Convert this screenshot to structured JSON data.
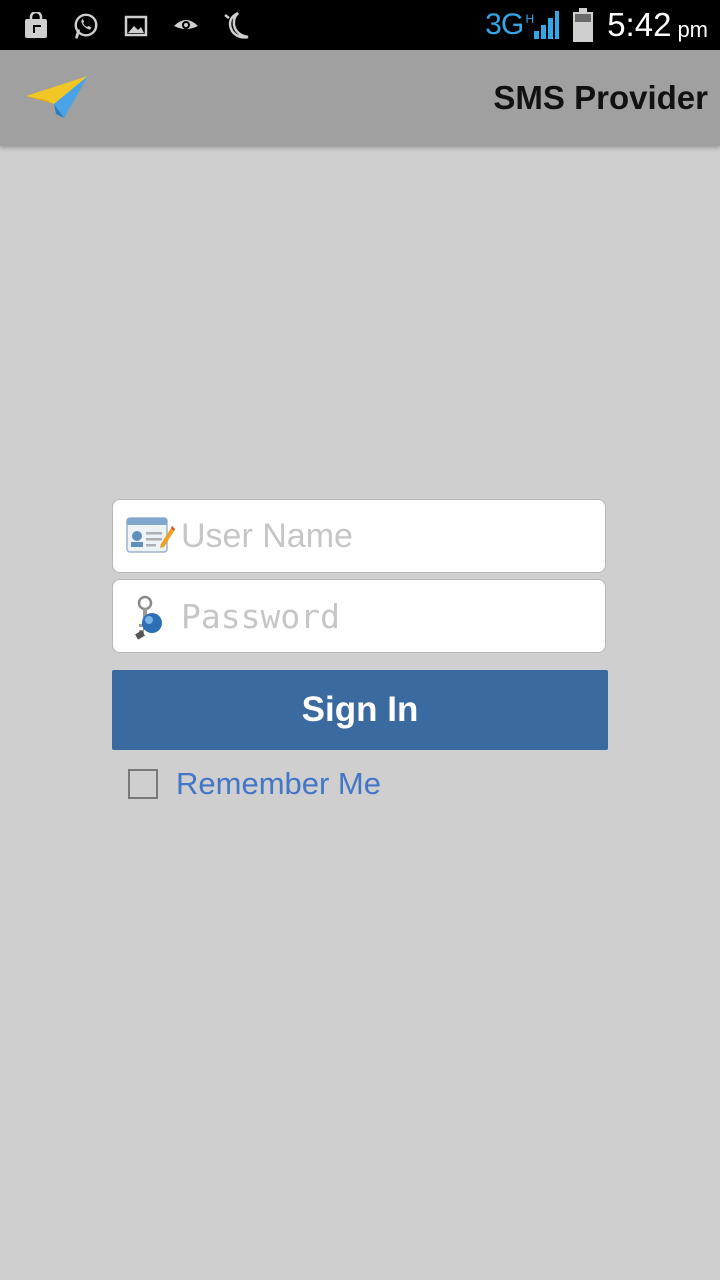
{
  "status_bar": {
    "icons": [
      "shop-bag-icon",
      "whatsapp-icon",
      "gallery-icon",
      "eye-icon",
      "moon-icon"
    ],
    "network": "3G",
    "network_sub": "H",
    "time": "5:42",
    "ampm": "pm"
  },
  "action_bar": {
    "title": "SMS Provider",
    "logo_icon": "paper-plane-icon"
  },
  "login": {
    "username_placeholder": "User Name",
    "username_value": "",
    "password_placeholder": "Password",
    "password_value": "",
    "signin_label": "Sign In",
    "remember_label": "Remember Me",
    "remember_checked": false
  },
  "colors": {
    "background": "#cfcfcf",
    "action_bar": "#a0a0a0",
    "button": "#3a6a9f",
    "link": "#4476c8",
    "network": "#33a7e8"
  }
}
